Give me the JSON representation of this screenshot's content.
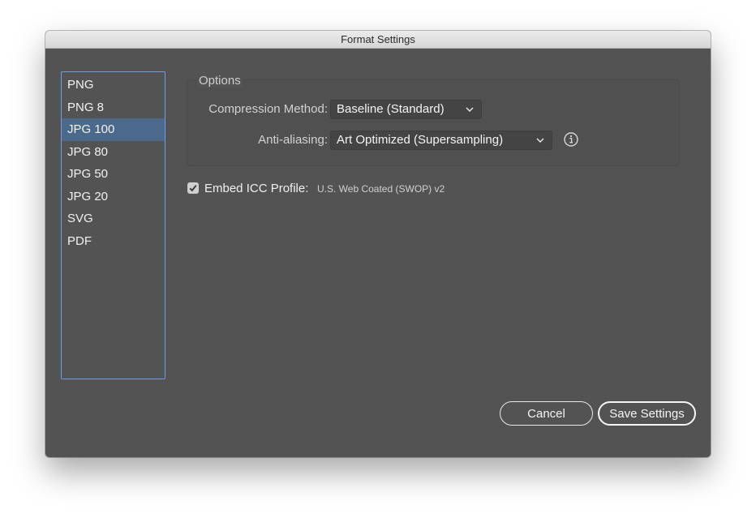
{
  "window": {
    "title": "Format Settings"
  },
  "format_list": {
    "items": [
      {
        "label": "PNG"
      },
      {
        "label": "PNG 8"
      },
      {
        "label": "JPG 100"
      },
      {
        "label": "JPG 80"
      },
      {
        "label": "JPG 50"
      },
      {
        "label": "JPG 20"
      },
      {
        "label": "SVG"
      },
      {
        "label": "PDF"
      }
    ],
    "selected": "JPG 100"
  },
  "options": {
    "legend": "Options",
    "compression_label": "Compression Method:",
    "compression_value": "Baseline (Standard)",
    "antialiasing_label": "Anti-aliasing:",
    "antialiasing_value": "Art Optimized (Supersampling)",
    "info_icon": "info-icon"
  },
  "embed_icc": {
    "checked": true,
    "label": "Embed ICC Profile:",
    "value": "U.S. Web Coated (SWOP) v2"
  },
  "buttons": {
    "cancel": "Cancel",
    "save": "Save Settings"
  },
  "colors": {
    "panel_bg": "#535353",
    "selection": "#4b6a8b",
    "list_focus_border": "#6d9ee4"
  }
}
